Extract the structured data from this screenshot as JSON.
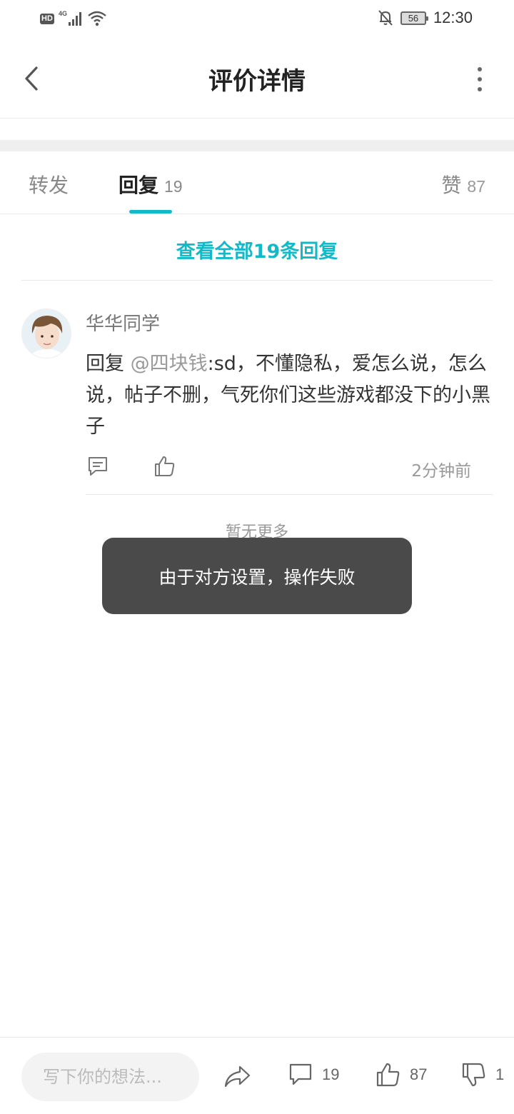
{
  "status_bar": {
    "hd_label": "HD",
    "network": "4G",
    "battery": "56",
    "time": "12:30"
  },
  "header": {
    "title": "评价详情"
  },
  "tabs": {
    "forward_label": "转发",
    "reply_label": "回复",
    "reply_count": "19",
    "like_label": "赞",
    "like_count": "87",
    "active": "reply"
  },
  "view_all_label": "查看全部19条回复",
  "comment": {
    "username": "华华同学",
    "reply_prefix": "回复 ",
    "mention": "@四块钱",
    "text": ":sd，不懂隐私，爱怎么说，怎么说，帖子不删，气死你们这些游戏都没下的小黑子",
    "time": "2分钟前"
  },
  "no_more_label": "暂无更多",
  "toast": {
    "message": "由于对方设置，操作失败"
  },
  "bottom_bar": {
    "input_placeholder": "写下你的想法...",
    "comment_count": "19",
    "like_count": "87",
    "dislike_count": "1"
  },
  "colors": {
    "accent": "#14b9c8",
    "toast_bg": "#4a4a4a"
  }
}
